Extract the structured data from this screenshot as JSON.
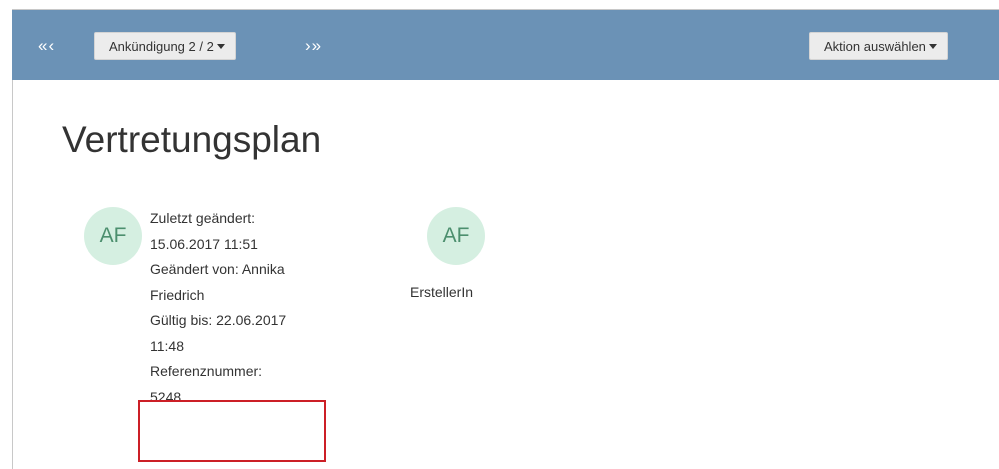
{
  "toolbar": {
    "first_label": "«‹",
    "last_label": "›»",
    "announcement_dropdown": "Ankündigung 2 / 2",
    "action_dropdown": "Aktion auswählen"
  },
  "page": {
    "title": "Vertretungsplan"
  },
  "meta": {
    "avatar_initials": "AF",
    "lines": [
      "Zuletzt geändert:",
      "15.06.2017 11:51",
      "Geändert von: Annika",
      "Friedrich",
      "Gültig bis: 22.06.2017",
      "11:48",
      "Referenznummer:",
      "5248"
    ]
  },
  "creator": {
    "avatar_initials": "AF",
    "label": "ErstellerIn"
  },
  "colors": {
    "toolbar_bg": "#6b92b6",
    "avatar_bg": "#d5efe1",
    "avatar_text": "#4c8f6e",
    "highlight_border": "#cc1f26"
  },
  "icons": {
    "first": "double-chevron-left-icon",
    "last": "double-chevron-right-icon",
    "caret": "caret-down-icon"
  }
}
